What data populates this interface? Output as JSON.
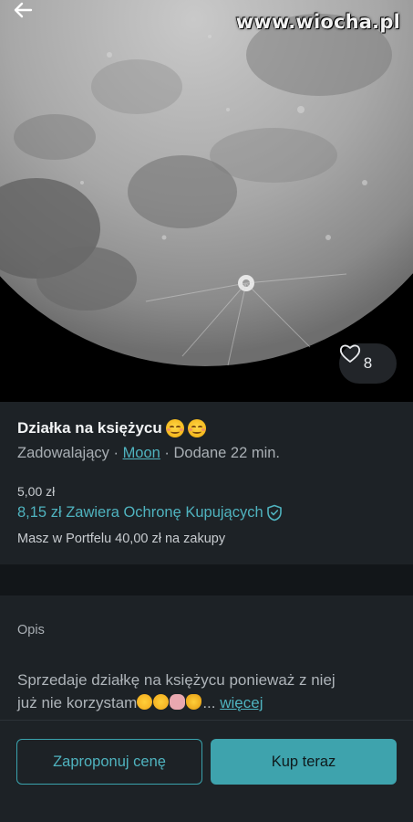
{
  "watermark": "www.wiocha.pl",
  "favorites": {
    "count": "8"
  },
  "item": {
    "title": "Działka na księżycu",
    "condition": "Zadowalający",
    "separator1": " · ",
    "brand": "Moon",
    "separator2": " · ",
    "added": "Dodane 22 min.",
    "price": "5,00 zł",
    "price_with_protection": "8,15 zł Zawiera Ochronę Kupujących",
    "wallet_note": "Masz w Portfelu 40,00 zł na zakupy"
  },
  "description": {
    "label": "Opis",
    "text_line1": "Sprzedaje działkę na księżycu ponieważ z niej",
    "text_line2": "już  nie korzystam",
    "ellipsis": "... ",
    "more": "więcej"
  },
  "actions": {
    "offer_label": "Zaproponuj cenę",
    "buy_label": "Kup teraz"
  },
  "colors": {
    "accent": "#4fb3bf",
    "buy_button": "#3ea3ad",
    "panel": "#1d2226",
    "separator": "#121619"
  }
}
